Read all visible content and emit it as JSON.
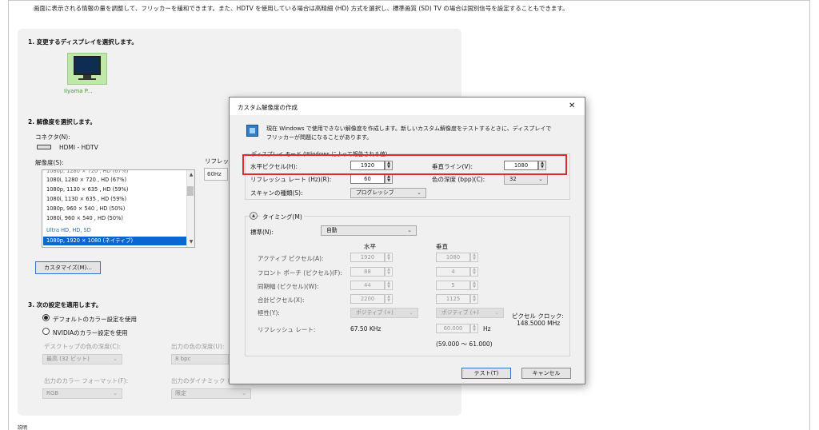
{
  "intro_text": "画面に表示される情報の量を調整して、フリッカーを緩和できます。また、HDTV を使用している場合は高精細 (HD) 方式を選択し、標準画質 (SD) TV の場合は国別信号を設定することもできます。",
  "sections": {
    "display_title": "1. 変更するディスプレイを選択します。",
    "display_name": "Iiyama P...",
    "resolution_title": "2. 解像度を選択します。",
    "connector_label": "コネクタ(N):",
    "connector_value": "HDMI - HDTV",
    "resolution_label": "解像度(S):",
    "refresh_label": "リフレッシ",
    "refresh_value": "60Hz",
    "customize_button": "カスタマイズ(M)...",
    "apply_title": "3. 次の設定を適用します。",
    "radio_default": "デフォルトのカラー設定を使用",
    "radio_nvidia": "NVIDIAのカラー設定を使用",
    "desktop_depth_label": "デスクトップの色の深度(C):",
    "desktop_depth_value": "最高 (32 ビット)",
    "output_depth_label": "出力の色の深度(U):",
    "output_depth_value": "8 bpc",
    "output_format_label": "出力のカラー フォーマット(F):",
    "output_format_value": "RGB",
    "dynamic_range_label": "出力のダイナミック レ",
    "dynamic_range_value": "限定",
    "bottom_cut_text": "説明"
  },
  "resolution_list": {
    "items": [
      "1080i, 1280 × 720 , HD (67%)",
      "1080p, 1130 × 635 , HD (59%)",
      "1080i, 1130 × 635 , HD (59%)",
      "1080p, 960 × 540 , HD (50%)",
      "1080i, 960 × 540 , HD (50%)"
    ],
    "category": "Ultra HD, HD, SD",
    "selected": "1080p, 1920 × 1080 (ネイティブ)"
  },
  "dialog": {
    "title": "カスタム解像度の作成",
    "desc_line1": "現在 Windows で使用できない解像度を作成します。新しいカスタム解像度をテストするときに、ディスプレイで",
    "desc_line2": "フリッカーが問題になることがあります。",
    "group_label": "ディスプレイ モード (Windows によって報告される値)",
    "h_pixels_label": "水平ピクセル(H):",
    "h_pixels_value": "1920",
    "v_lines_label": "垂直ライン(V):",
    "v_lines_value": "1080",
    "refresh_label": "リフレッシュ レート (Hz)(R):",
    "refresh_value": "60",
    "color_depth_label": "色の深度 (bpp)(C):",
    "color_depth_value": "32",
    "scan_label": "スキャンの種類(S):",
    "scan_value": "プログレッシブ",
    "timing_label": "タイミング(M)",
    "standard_label": "標準(N):",
    "standard_value": "自動",
    "col_horizontal": "水平",
    "col_vertical": "垂直",
    "active_label": "アクティブ ピクセル(A):",
    "active_h": "1920",
    "active_v": "1080",
    "front_porch_label": "フロント ポーチ (ピクセル)(F):",
    "front_porch_h": "88",
    "front_porch_v": "4",
    "sync_width_label": "同期幅 (ピクセル)(W):",
    "sync_width_h": "44",
    "sync_width_v": "5",
    "total_label": "合計ピクセル(X):",
    "total_h": "2200",
    "total_v": "1125",
    "polarity_label": "極性(Y):",
    "polarity_h": "ポジティブ (+)",
    "polarity_v": "ポジティブ (+)",
    "pixel_clock_label": "ピクセル クロック:",
    "pixel_clock_value": "148.5000 MHz",
    "refresh_rate_label": "リフレッシュ レート:",
    "refresh_h_value": "67.50 KHz",
    "refresh_v_value": "60.000",
    "hz_unit": "Hz",
    "range_text": "(59.000 ～ 61.000)",
    "test_button": "テスト(T)",
    "cancel_button": "キャンセル",
    "close_glyph": "✕"
  },
  "colors": {
    "highlight_box": "#e02b2b",
    "selection": "#0a66d1",
    "monitor_name": "#3f9b2c"
  }
}
